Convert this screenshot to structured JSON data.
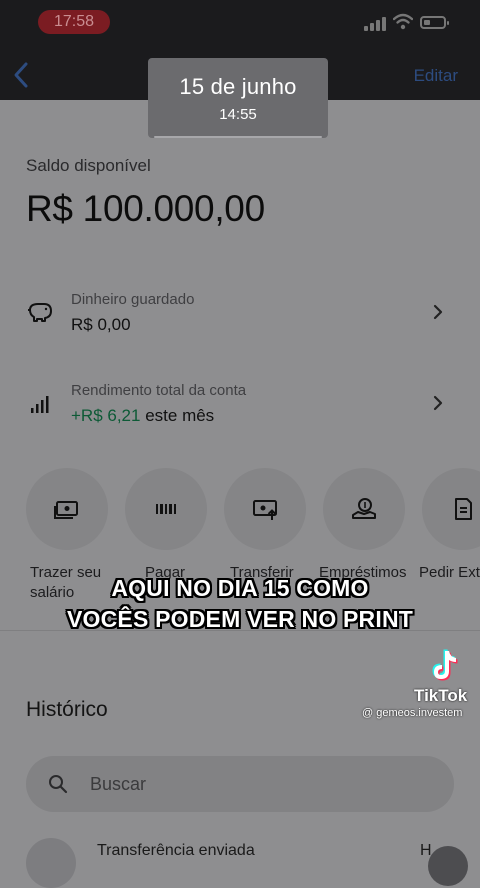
{
  "status_bar": {
    "time": "17:58"
  },
  "nav": {
    "edit_label": "Editar"
  },
  "date_overlay": {
    "date": "15 de junho",
    "time": "14:55"
  },
  "balance": {
    "label": "Saldo disponível",
    "value": "R$ 100.000,00"
  },
  "rows": [
    {
      "title": "Dinheiro guardado",
      "value": "R$ 0,00"
    },
    {
      "title": "Rendimento total da conta",
      "value_green": "+R$ 6,21",
      "value_suffix": " este mês"
    }
  ],
  "actions": [
    {
      "label_line1": "Trazer seu",
      "label_line2": "salário",
      "icon": "receive-money-icon"
    },
    {
      "label_line1": "Pagar",
      "icon": "barcode-icon"
    },
    {
      "label_line1": "Transferir",
      "icon": "transfer-icon"
    },
    {
      "label_line1": "Empréstimos",
      "icon": "loan-icon"
    },
    {
      "label_line1": "Pedir Ext",
      "icon": "statement-icon"
    }
  ],
  "caption": {
    "line1": "AQUI NO DIA 15 COMO",
    "line2": "VOCÊS PODEM VER NO PRINT"
  },
  "history": {
    "title": "Histórico",
    "search_placeholder": "Buscar"
  },
  "transaction": {
    "title": "Transferência enviada",
    "right_text": "H"
  },
  "watermark": {
    "brand": "TikTok",
    "handle": "@ gemeos.investem"
  },
  "colors": {
    "status_red": "#7b1c22",
    "green_value": "#0d5a36",
    "link_blue": "#2d4c80"
  }
}
